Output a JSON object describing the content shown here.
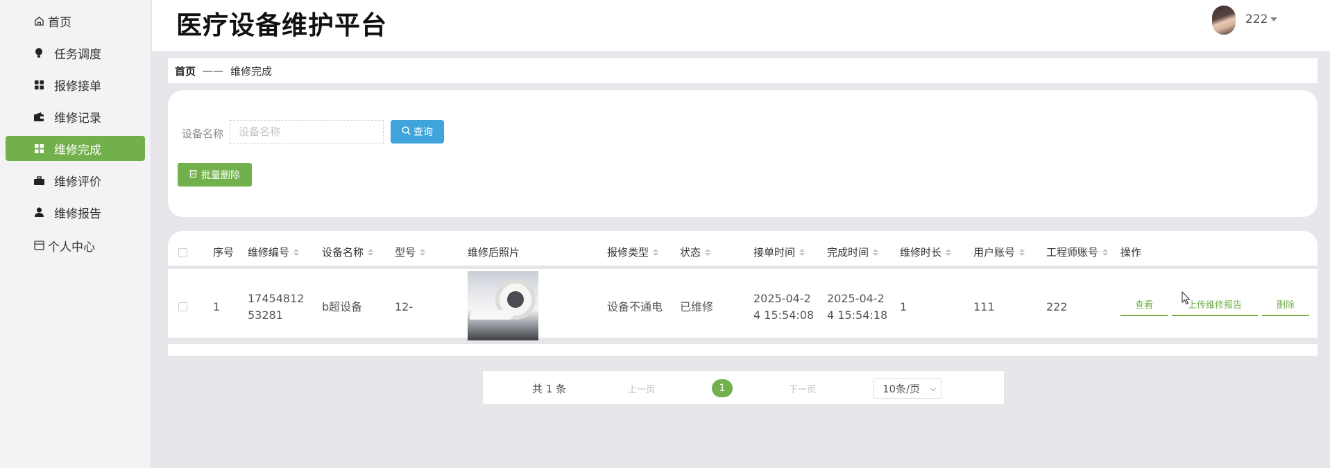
{
  "app": {
    "title": "医疗设备维护平台"
  },
  "user": {
    "name": "222"
  },
  "sidebar": {
    "items": [
      {
        "label": "首页",
        "icon": "home-icon"
      },
      {
        "label": "任务调度",
        "icon": "lightbulb-icon"
      },
      {
        "label": "报修接单",
        "icon": "grid-icon"
      },
      {
        "label": "维修记录",
        "icon": "wallet-icon"
      },
      {
        "label": "维修完成",
        "icon": "grid-icon",
        "active": true
      },
      {
        "label": "维修评价",
        "icon": "briefcase-icon"
      },
      {
        "label": "维修报告",
        "icon": "person-icon"
      },
      {
        "label": "个人中心",
        "icon": "folder-icon"
      }
    ]
  },
  "breadcrumb": {
    "home": "首页",
    "separator": "——",
    "current": "维修完成"
  },
  "search": {
    "label": "设备名称",
    "placeholder": "设备名称",
    "value": "",
    "query_label": "查询",
    "batch_delete_label": "批量删除"
  },
  "table": {
    "headers": [
      "序号",
      "维修编号",
      "设备名称",
      "型号",
      "维修后照片",
      "报修类型",
      "状态",
      "接单时间",
      "完成时间",
      "维修时长",
      "用户账号",
      "工程师账号",
      "操作"
    ],
    "rows": [
      {
        "index": "1",
        "repair_no": [
          "17454812",
          "53281"
        ],
        "device_name": "b超设备",
        "model": "12-",
        "repair_type": "设备不通电",
        "status": "已维修",
        "accept_time": [
          "2025-04-2",
          "4 15:54:08"
        ],
        "finish_time": [
          "2025-04-2",
          "4 15:54:18"
        ],
        "duration": "1",
        "user_account": "111",
        "engineer_account": "222",
        "actions": [
          "查看",
          "上传维修报告",
          "删除"
        ]
      }
    ]
  },
  "pagination": {
    "total": "共 1 条",
    "prev": "上一页",
    "current": "1",
    "next": "下一页",
    "page_size": "10条/页"
  },
  "colors": {
    "accent_green": "#71b04b",
    "query_blue": "#3fa3dc",
    "background": "#e8e6ea"
  }
}
